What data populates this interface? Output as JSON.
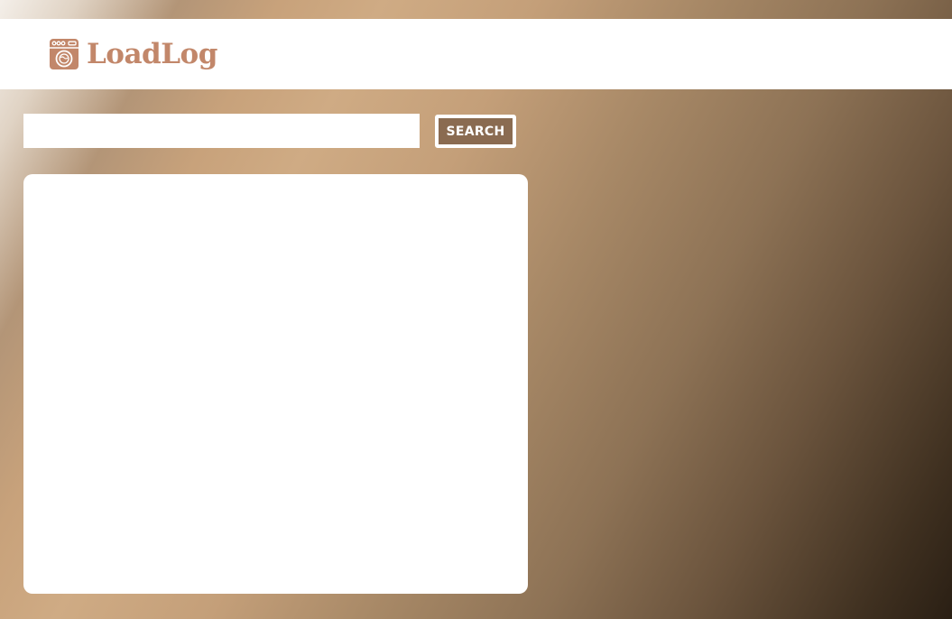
{
  "header": {
    "brand_name": "LoadLog",
    "logo_icon": "washing-machine-icon",
    "brand_color": "#c2876a"
  },
  "search": {
    "value": "",
    "placeholder": "",
    "button_label": "SEARCH",
    "button_color": "#8a6b51"
  },
  "results": {
    "items": []
  }
}
